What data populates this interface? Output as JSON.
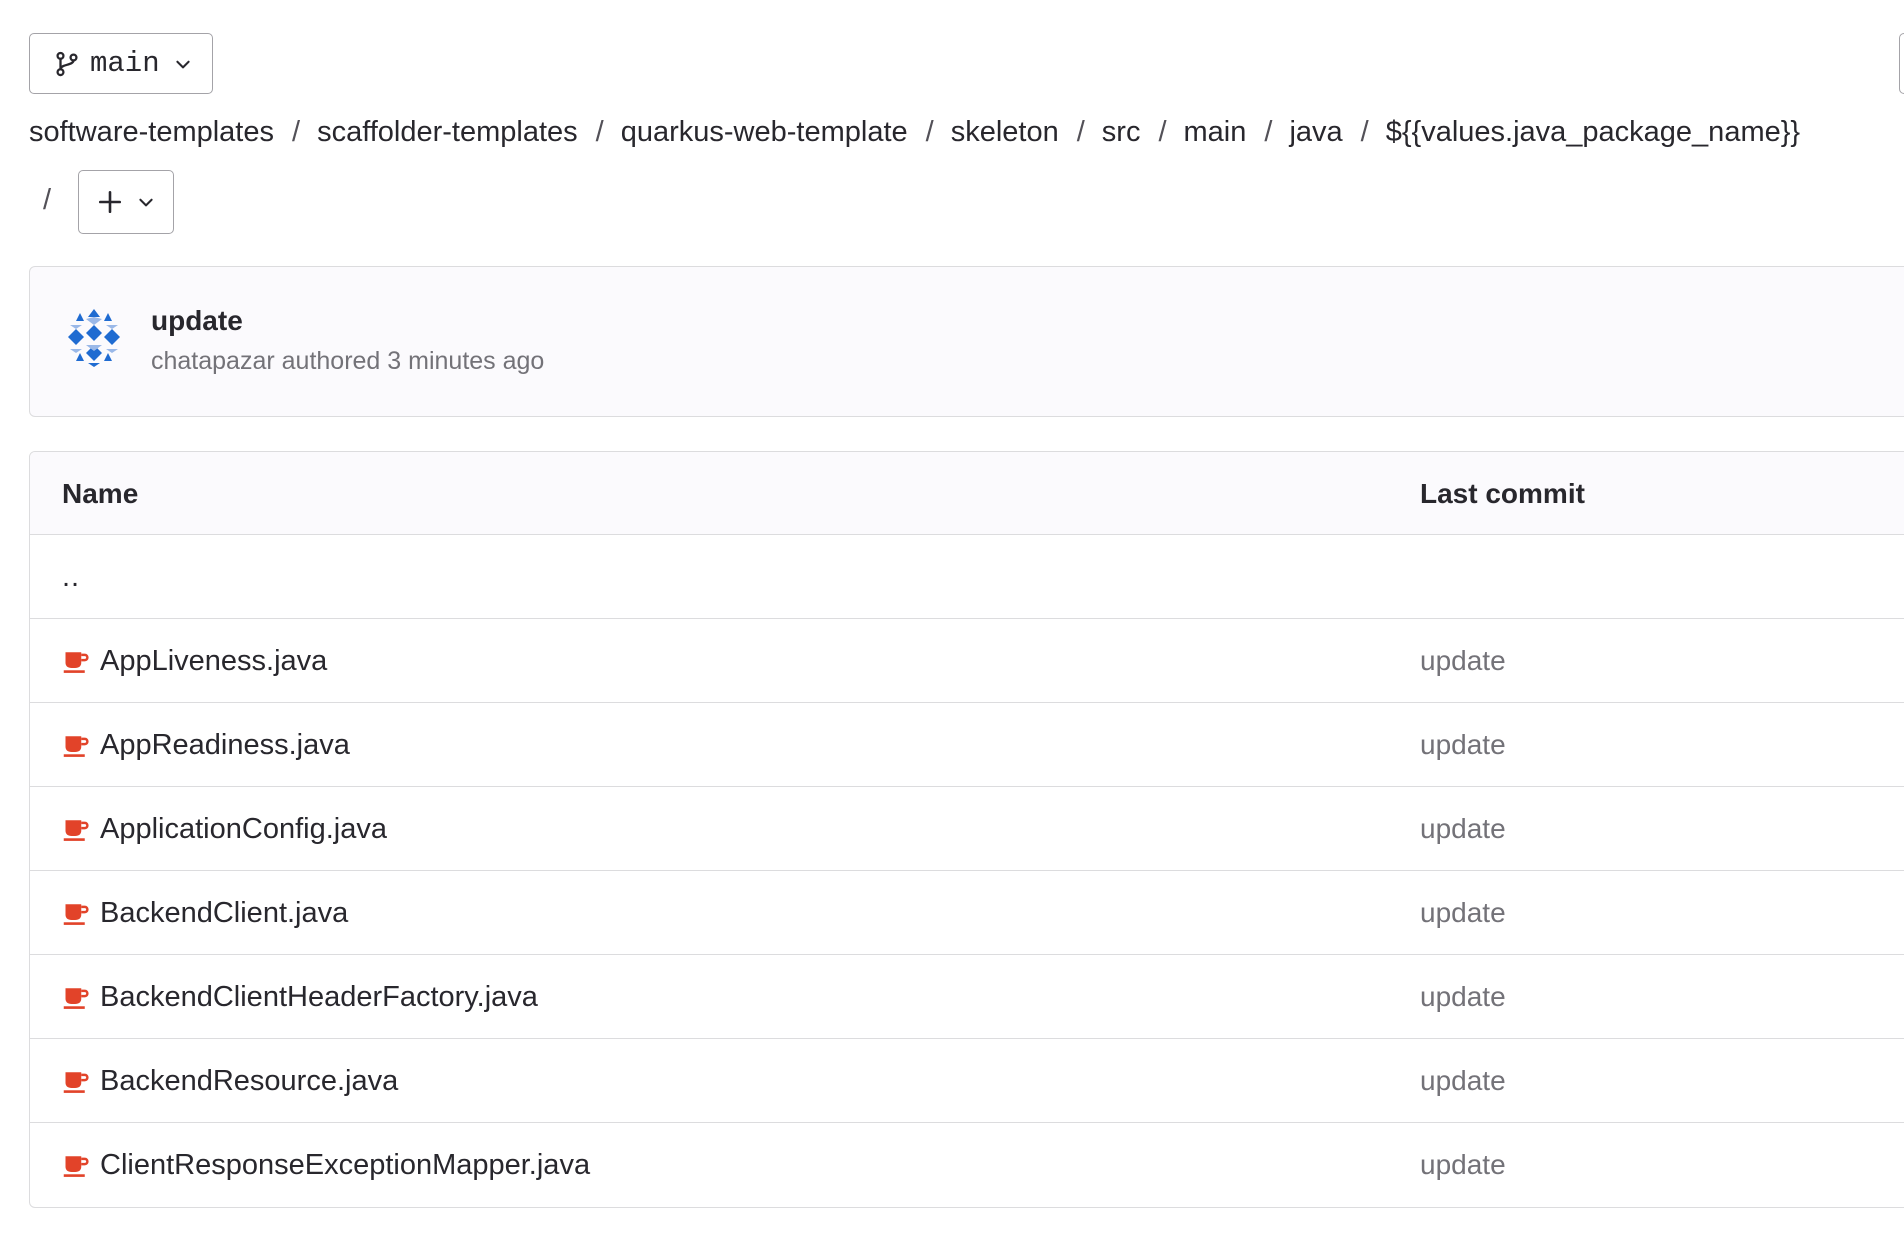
{
  "branch": {
    "name": "main"
  },
  "breadcrumb": {
    "items": [
      "software-templates",
      "scaffolder-templates",
      "quarkus-web-template",
      "skeleton",
      "src",
      "main",
      "java",
      "${{values.java_package_name}}"
    ],
    "separator": "/"
  },
  "commit": {
    "title": "update",
    "author": "chatapazar",
    "meta": "chatapazar authored 3 minutes ago"
  },
  "table": {
    "columns": {
      "name": "Name",
      "last_commit": "Last commit"
    },
    "parent": "..",
    "rows": [
      {
        "name": "AppLiveness.java",
        "commit": "update"
      },
      {
        "name": "AppReadiness.java",
        "commit": "update"
      },
      {
        "name": "ApplicationConfig.java",
        "commit": "update"
      },
      {
        "name": "BackendClient.java",
        "commit": "update"
      },
      {
        "name": "BackendClientHeaderFactory.java",
        "commit": "update"
      },
      {
        "name": "BackendResource.java",
        "commit": "update"
      },
      {
        "name": "ClientResponseExceptionMapper.java",
        "commit": "update"
      }
    ]
  },
  "colors": {
    "text": "#28272d",
    "muted": "#737278",
    "border": "#dcdcde",
    "java_icon": "#e24329",
    "avatar_blue": "#1f6bd1"
  }
}
